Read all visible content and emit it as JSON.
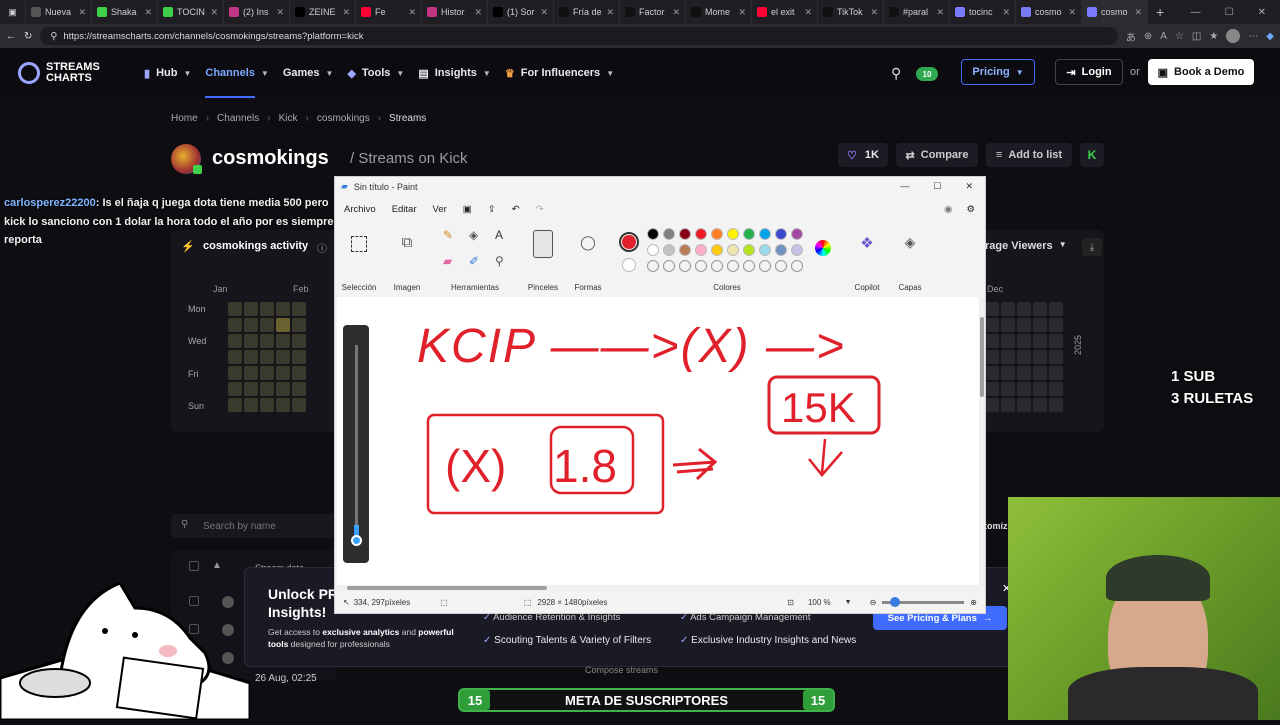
{
  "browser": {
    "tabs": [
      "Nueva",
      "Shaka",
      "TOCIN",
      "(2) Ins",
      "ZEINE",
      "Fe",
      "Histor",
      "(1) Sor",
      "Fría de",
      "Factor",
      "Mome",
      "el exit",
      "TikTok",
      "#paral",
      "tocinc",
      "cosmo",
      "cosmo"
    ],
    "url": "https://streamscharts.com/channels/cosmokings/streams?platform=kick"
  },
  "site": {
    "logo_line1": "STREAMS",
    "logo_line2": "CHARTS",
    "nav": [
      "Hub",
      "Channels",
      "Games",
      "Tools",
      "Insights",
      "For Influencers"
    ],
    "pricing": "Pricing",
    "login": "Login",
    "or": "or",
    "book_demo": "Book a Demo",
    "notif_count": "10"
  },
  "page": {
    "breadcrumb": [
      "Home",
      "Channels",
      "Kick",
      "cosmokings",
      "Streams"
    ],
    "channel_name": "cosmokings",
    "subtitle": "/ Streams on Kick",
    "likes": "1K",
    "compare": "Compare",
    "add_to_list": "Add to list",
    "activity_title": "cosmokings activity",
    "months": [
      "Jan",
      "Feb"
    ],
    "dec_label": "Dec",
    "year": "2025",
    "days": [
      "Mon",
      "Wed",
      "Fri",
      "Sun"
    ],
    "avg_viewers": "rage Viewers",
    "search_placeholder": "Search by name",
    "stream_date_head": "Stream date",
    "row_date": "26 Aug, 02:25",
    "compose": "Compose streams",
    "customize": "tomiz"
  },
  "promo": {
    "title_line1": "Unlock PR",
    "title_line2": "Insights!",
    "desc_pre": "Get access to ",
    "desc_b1": "exclusive analytics",
    "desc_mid": " and ",
    "desc_b2": "powerful tools",
    "desc_post": " designed for professionals",
    "features": [
      "Audience Retention & Insights",
      "Ads Campaign Management",
      "Scouting Talents & Variety of Filters",
      "Exclusive Industry Insights and News"
    ],
    "cta": "See Pricing & Plans"
  },
  "chat": {
    "user": "carlosperez22200",
    "message": ": Is el ñaja q juega dota tiene media 500 pero kick lo sanciono con 1 dolar la hora todo el año por es siempre reporta"
  },
  "paint": {
    "title": "Sin título - Paint",
    "menu": [
      "Archivo",
      "Editar",
      "Ver"
    ],
    "groups": [
      "Selección",
      "Imagen",
      "Herramientas",
      "Pinceles",
      "Formas",
      "Colores",
      "Copilot",
      "Capas"
    ],
    "cursor_pos": "334, 297píxeles",
    "canvas_size": "2928 × 1480píxeles",
    "zoom": "100 %",
    "palette": [
      "#000000",
      "#7f7f7f",
      "#880015",
      "#ed1c24",
      "#ff7f27",
      "#fff200",
      "#22b14c",
      "#00a2e8",
      "#3f48cc",
      "#a349a4",
      "#ffffff",
      "#c3c3c3",
      "#b97a57",
      "#ffaec9",
      "#ffc90e",
      "#efe4b0",
      "#b5e61d",
      "#99d9ea",
      "#7092be",
      "#c8bfe7"
    ],
    "primary_color": "#e0202a",
    "ink_color": "#e0202a",
    "drawing": {
      "line1": "KCIP ——>(X) —>",
      "box_right": "15K",
      "box_left_x": "(X)",
      "box_left_num": "1.8"
    }
  },
  "overlay": {
    "sub_line1": "1 SUB",
    "sub_line2": "3 RULETAS",
    "goal_label": "META DE SUSCRIPTORES",
    "goal_left": "15",
    "goal_right": "15"
  }
}
